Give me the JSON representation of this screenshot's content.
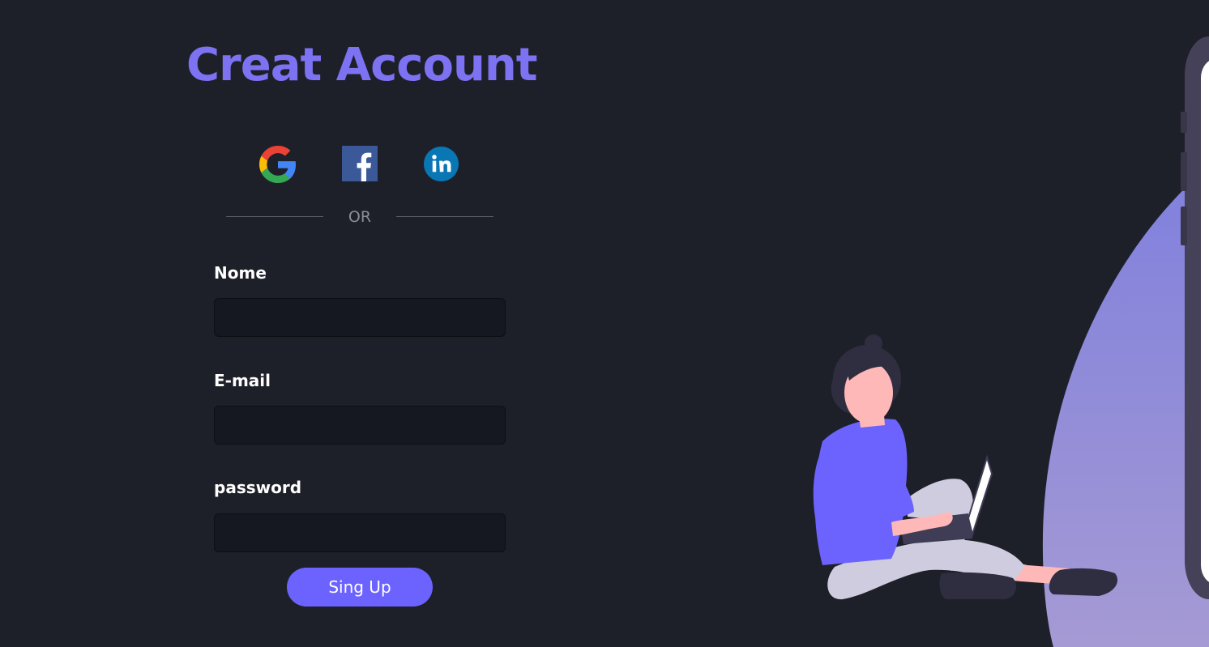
{
  "page": {
    "title": "Creat Account"
  },
  "social": {
    "google_icon": "google-icon",
    "facebook_icon": "facebook-icon",
    "linkedin_icon": "linkedin-icon"
  },
  "divider": {
    "text": "OR"
  },
  "form": {
    "name_label": "Nome",
    "name_value": "",
    "email_label": "E-mail",
    "email_value": "",
    "password_label": "password",
    "password_value": "",
    "submit_label": "Sing Up"
  },
  "colors": {
    "background": "#1e2029",
    "accent": "#6c63ff",
    "title": "#7c72f2",
    "input_background": "#161821"
  }
}
